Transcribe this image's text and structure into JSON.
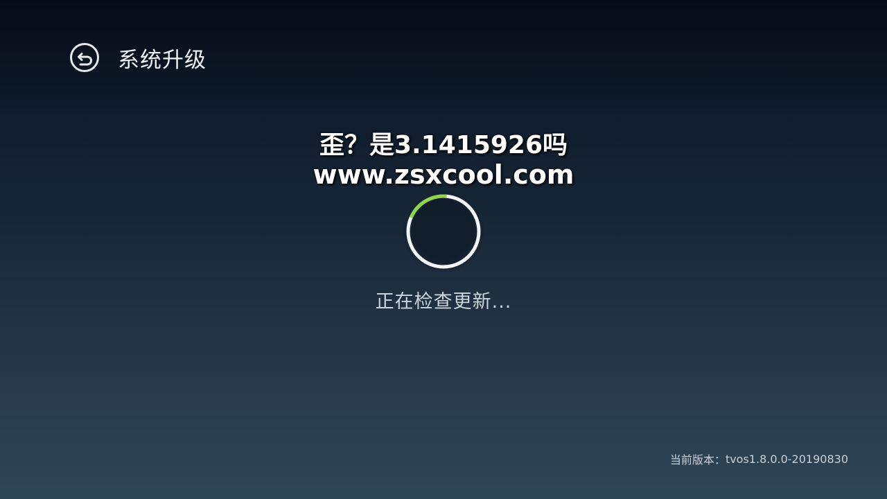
{
  "header": {
    "back_icon": "back-arrow-circle-icon",
    "title": "系统升级"
  },
  "watermark": {
    "line1": "歪？是3.1415926吗",
    "line2": "www.zsxcool.com"
  },
  "progress": {
    "icon": "loading-spinner-icon",
    "fraction": 0.2,
    "accent_color": "#8fd44a",
    "track_color": "#f2f4f5",
    "status": "正在检查更新..."
  },
  "footer": {
    "version_label": "当前版本：",
    "version_value": "tvos1.8.0.0-20190830"
  }
}
